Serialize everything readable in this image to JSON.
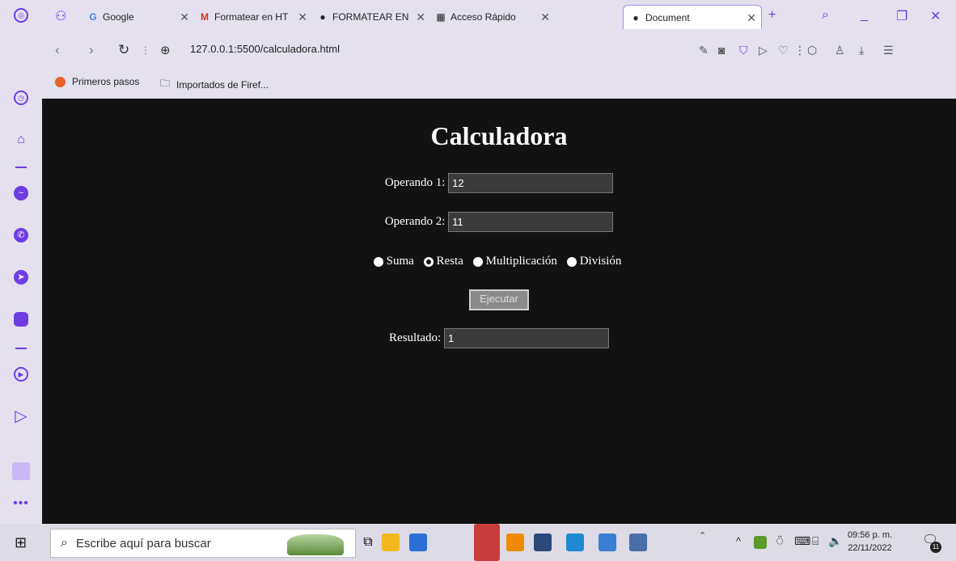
{
  "browser": {
    "tabs": [
      {
        "title": "Google"
      },
      {
        "title": "Formatear en HT"
      },
      {
        "title": "FORMATEAR EN"
      },
      {
        "title": "Acceso Rápido"
      },
      {
        "title": "Document"
      }
    ],
    "url": "127.0.0.1:5500/calculadora.html",
    "bookmarks": [
      "Primeros pasos",
      "Importados de Firef..."
    ]
  },
  "page": {
    "title": "Calculadora",
    "operando1_label": "Operando 1:",
    "operando1_value": "12",
    "operando2_label": "Operando 2:",
    "operando2_value": "11",
    "operations": [
      {
        "label": "Suma",
        "checked": false
      },
      {
        "label": "Resta",
        "checked": true
      },
      {
        "label": "Multiplicación",
        "checked": false
      },
      {
        "label": "División",
        "checked": false
      }
    ],
    "execute_label": "Ejecutar",
    "result_label": "Resultado:",
    "result_value": "1"
  },
  "taskbar": {
    "search_placeholder": "Escribe aquí para buscar",
    "time": "09:56 p. m.",
    "date": "22/11/2022",
    "notification_count": "11"
  },
  "colors": {
    "accent": "#6e3de2",
    "page_bg": "#121212"
  }
}
